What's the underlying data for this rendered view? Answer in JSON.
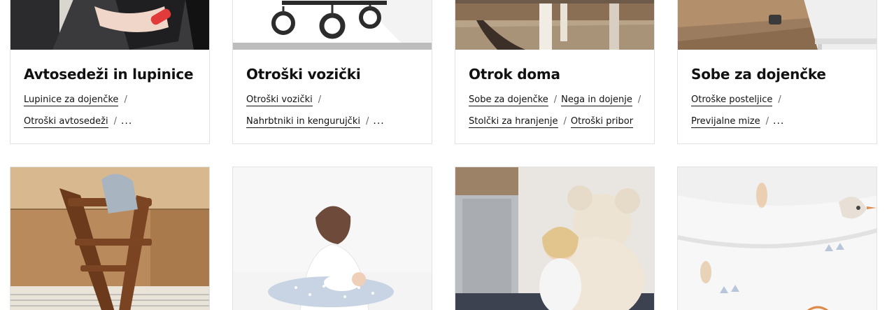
{
  "categories": [
    {
      "title": "Avtosedeži in lupinice",
      "links": [
        "Lupinice za dojenčke",
        "Otroški avtosedeži"
      ],
      "more": "..."
    },
    {
      "title": "Otroški vozički",
      "links": [
        "Otroški vozički",
        "Nahrbtniki in kengurujčki"
      ],
      "more": "..."
    },
    {
      "title": "Otrok doma",
      "links": [
        "Sobe za dojenčke",
        "Nega in dojenje",
        "Stolčki za hranjenje",
        "Otroški pribor"
      ],
      "more": ""
    },
    {
      "title": "Sobe za dojenčke",
      "links": [
        "Otroške posteljice",
        "Previjalne mize"
      ],
      "more": "..."
    }
  ],
  "separator": "/",
  "images": {
    "row1": [
      "car-seat-photo",
      "stroller-photo",
      "dining-chair-photo",
      "crib-room-photo"
    ],
    "row2": [
      "wooden-high-chair-photo",
      "nursing-pillow-photo",
      "girl-with-teddy-bear-photo",
      "baby-bedding-pattern-photo"
    ]
  }
}
